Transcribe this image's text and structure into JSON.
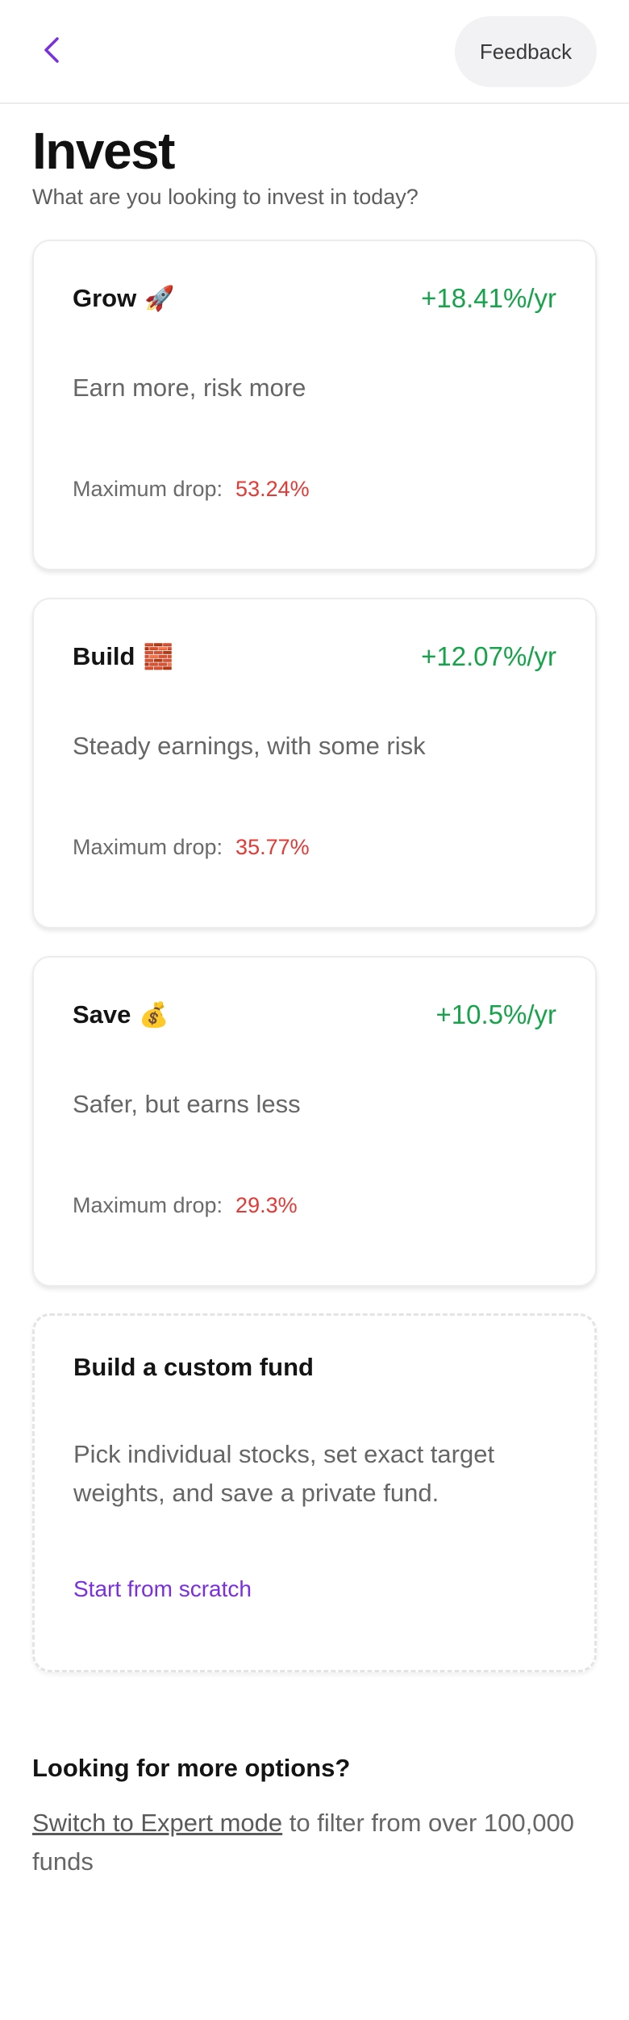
{
  "header": {
    "back_icon": "chevron-left-icon",
    "feedback_label": "Feedback",
    "accent_color": "#7a2fe0"
  },
  "page": {
    "title": "Invest",
    "subtitle": "What are you looking to invest in today?"
  },
  "funds": [
    {
      "name": "Grow",
      "emoji": "🚀",
      "rate": "+18.41%/yr",
      "description": "Earn more, risk more",
      "drop_label": "Maximum drop:",
      "drop_value": "53.24%"
    },
    {
      "name": "Build",
      "emoji": "🧱",
      "rate": "+12.07%/yr",
      "description": "Steady earnings, with some risk",
      "drop_label": "Maximum drop:",
      "drop_value": "35.77%"
    },
    {
      "name": "Save",
      "emoji": "💰",
      "rate": "+10.5%/yr",
      "description": "Safer, but earns less",
      "drop_label": "Maximum drop:",
      "drop_value": "29.3%"
    }
  ],
  "custom_fund": {
    "title": "Build a custom fund",
    "description": "Pick individual stocks, set exact target weights, and save a private fund.",
    "link_label": "Start from scratch"
  },
  "more_options": {
    "title": "Looking for more options?",
    "link_label": "Switch to Expert mode",
    "text": " to filter from over 100,000 funds"
  },
  "colors": {
    "positive": "#16a34a",
    "negative": "#e53935"
  }
}
